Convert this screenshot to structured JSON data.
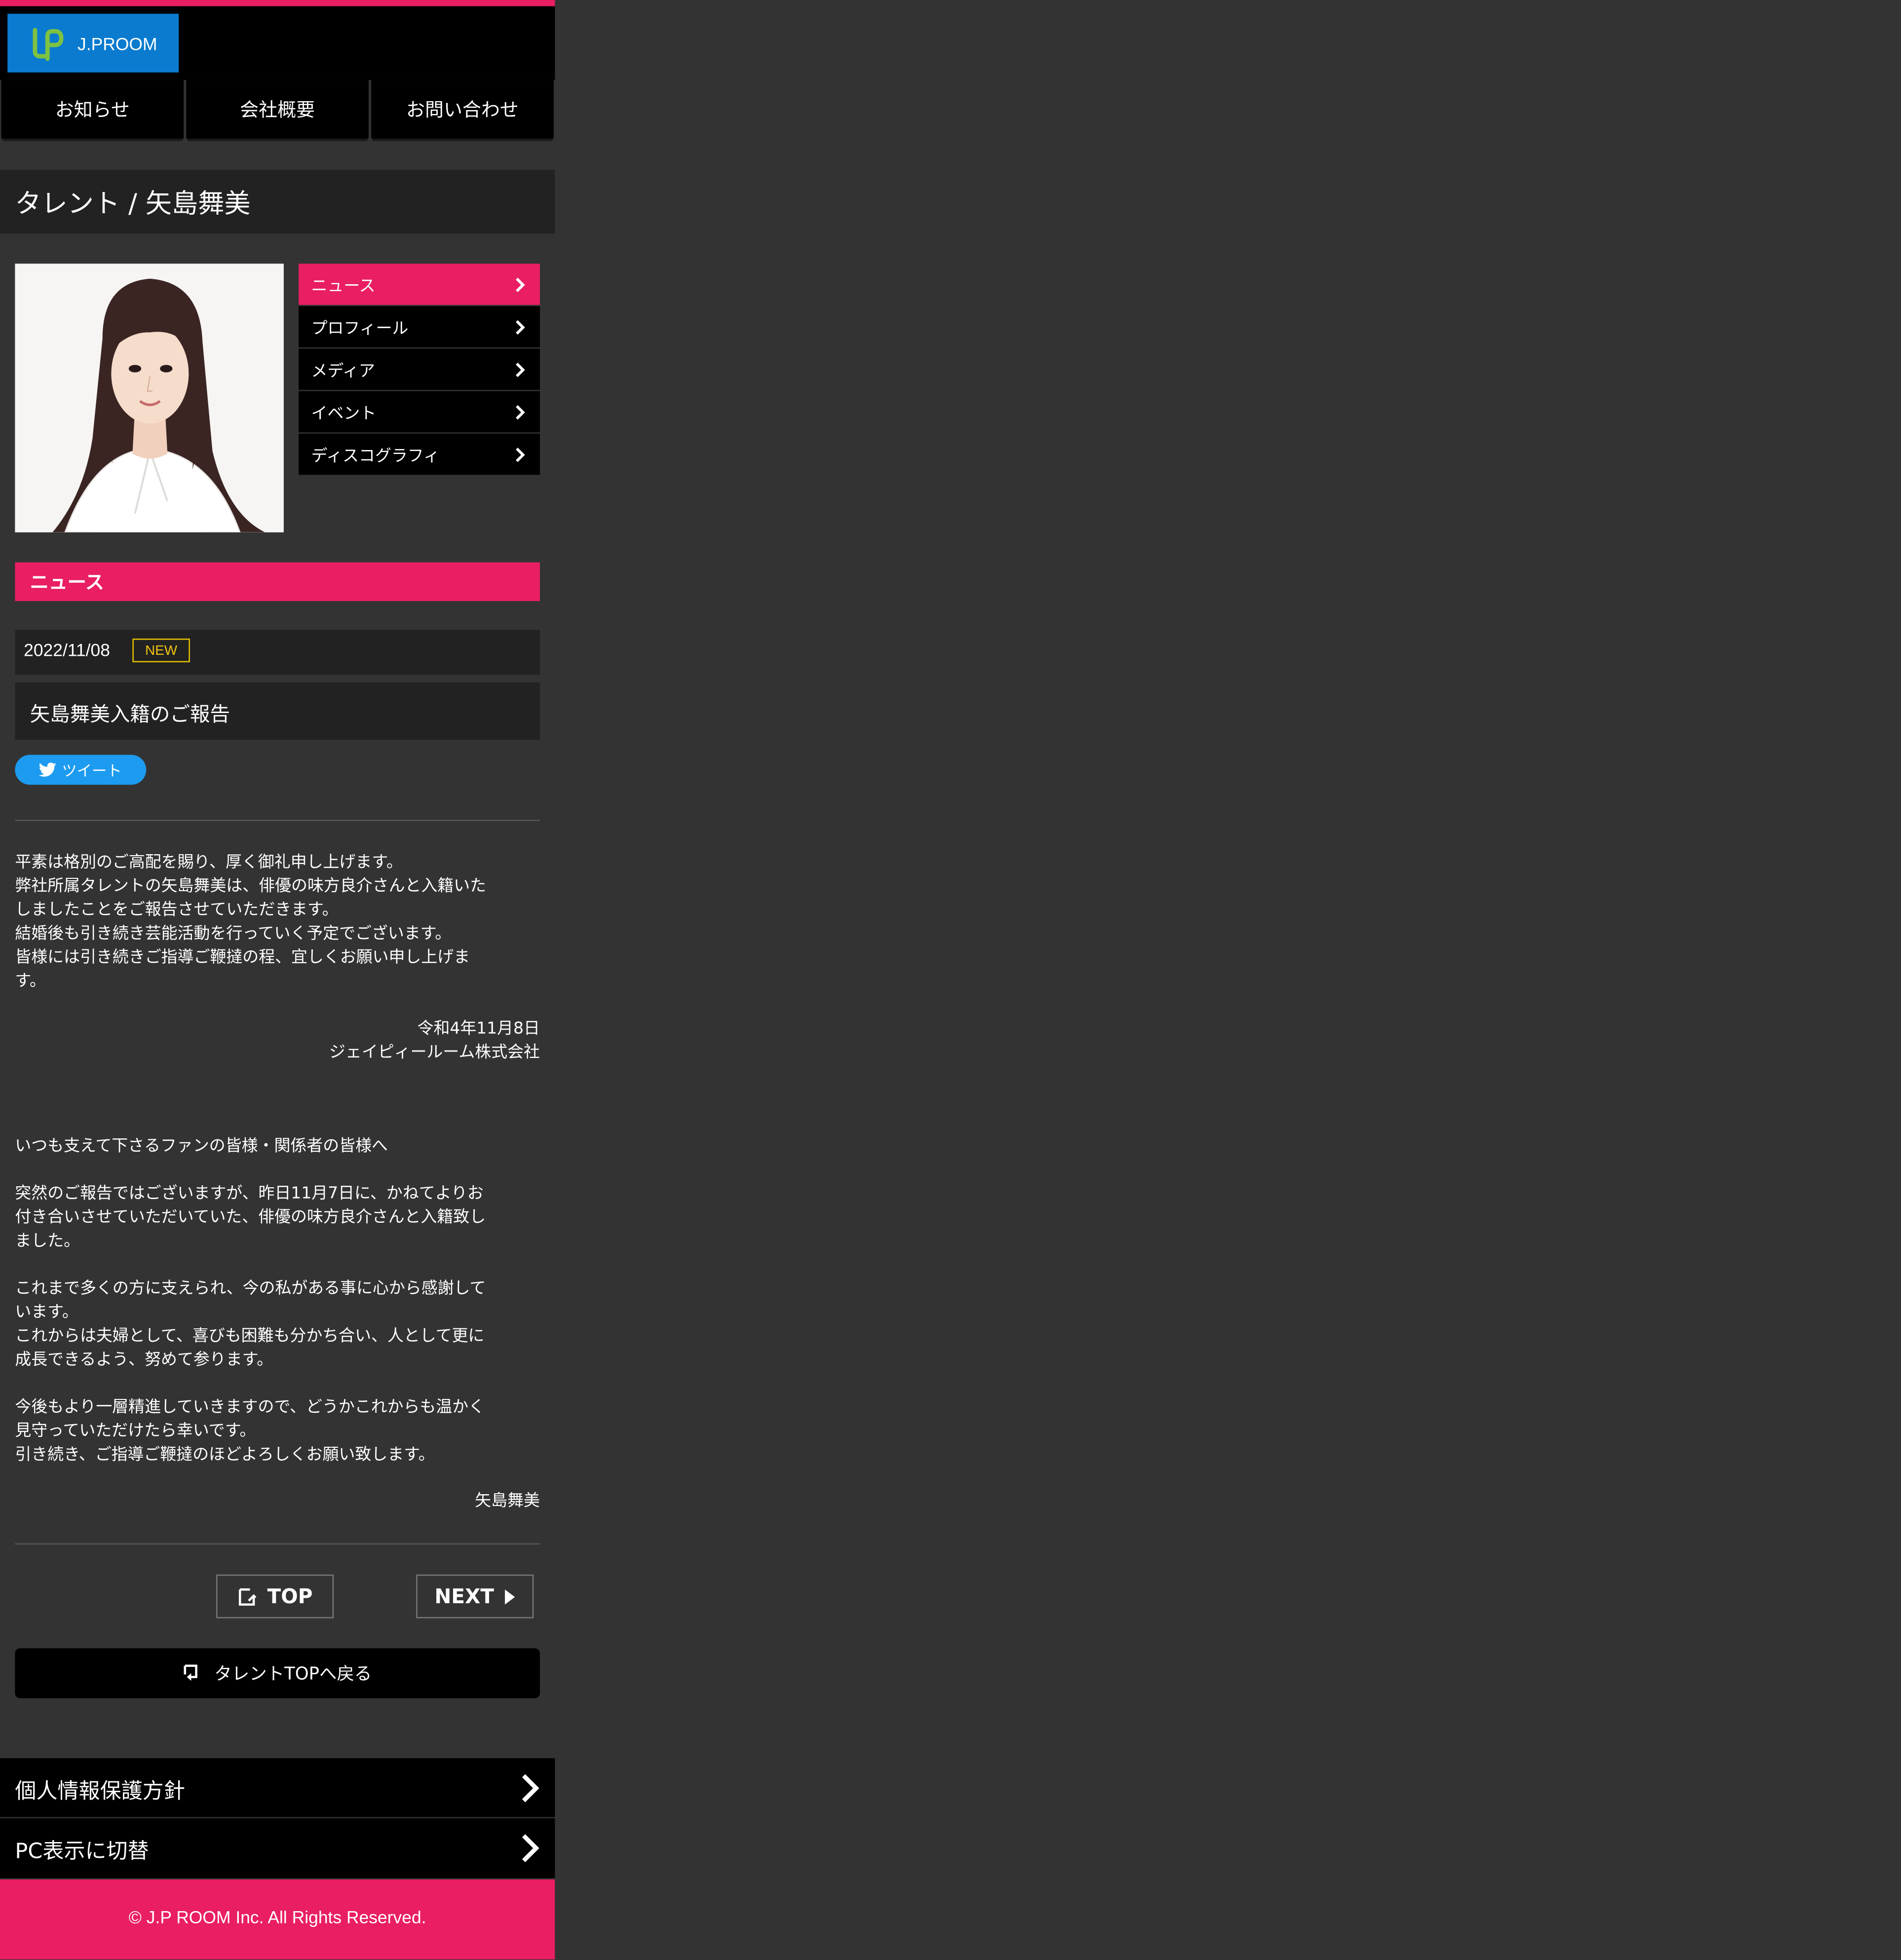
{
  "header": {
    "logo_text": "J.PROOM"
  },
  "global_nav": [
    "お知らせ",
    "会社概要",
    "お問い合わせ"
  ],
  "page_title": "タレント / 矢島舞美",
  "talent_menu": [
    {
      "label": "ニュース",
      "active": true
    },
    {
      "label": "プロフィール",
      "active": false
    },
    {
      "label": "メディア",
      "active": false
    },
    {
      "label": "イベント",
      "active": false
    },
    {
      "label": "ディスコグラフィ",
      "active": false
    }
  ],
  "section_title": "ニュース",
  "news": {
    "date": "2022/11/08",
    "badge": "NEW",
    "title": "矢島舞美入籍のご報告",
    "tweet_label": "ツイート",
    "company_lines": [
      "平素は格別のご高配を賜り、厚く御礼申し上げます。",
      "弊社所属タレントの矢島舞美は、俳優の味方良介さんと入籍いた",
      "しましたことをご報告させていただきます。",
      "結婚後も引き続き芸能活動を行っていく予定でございます。",
      "皆様には引き続きご指導ご鞭撻の程、宜しくお願い申し上げま",
      "す。"
    ],
    "company_date": "令和4年11月8日",
    "company_name": "ジェイピィールーム株式会社",
    "message_lines": [
      "いつも支えて下さるファンの皆様・関係者の皆様へ",
      "",
      "突然のご報告ではございますが、昨日11月7日に、かねてよりお",
      "付き合いさせていただいていた、俳優の味方良介さんと入籍致し",
      "ました。",
      "",
      "これまで多くの方に支えられ、今の私がある事に心から感謝して",
      "います。",
      "これからは夫婦として、喜びも困難も分かち合い、人として更に",
      "成長できるよう、努めて参ります。",
      "",
      "今後もより一層精進していきますので、どうかこれからも温かく",
      "見守っていただけたら幸いです。",
      "引き続き、ご指導ご鞭撻のほどよろしくお願い致します。"
    ],
    "signature": "矢島舞美"
  },
  "pager": {
    "top_label": "TOP",
    "next_label": "NEXT"
  },
  "back_label": "タレントTOPへ戻る",
  "footer_links": [
    "個人情報保護方針",
    "PC表示に切替"
  ],
  "copyright": "© J.P ROOM Inc. All Rights Reserved.",
  "colors": {
    "accent": "#e91e63",
    "logo_bg": "#0a7bcf",
    "page_bg": "#333333",
    "badge": "#f1c40f",
    "twitter": "#1d9bf0"
  },
  "icons": {
    "logo": "jp-logo-icon",
    "menu_arrow": "chevron-right-icon",
    "tweet": "twitter-bird-icon",
    "top": "top-page-icon",
    "next": "play-arrow-icon",
    "back": "return-arrow-icon"
  }
}
